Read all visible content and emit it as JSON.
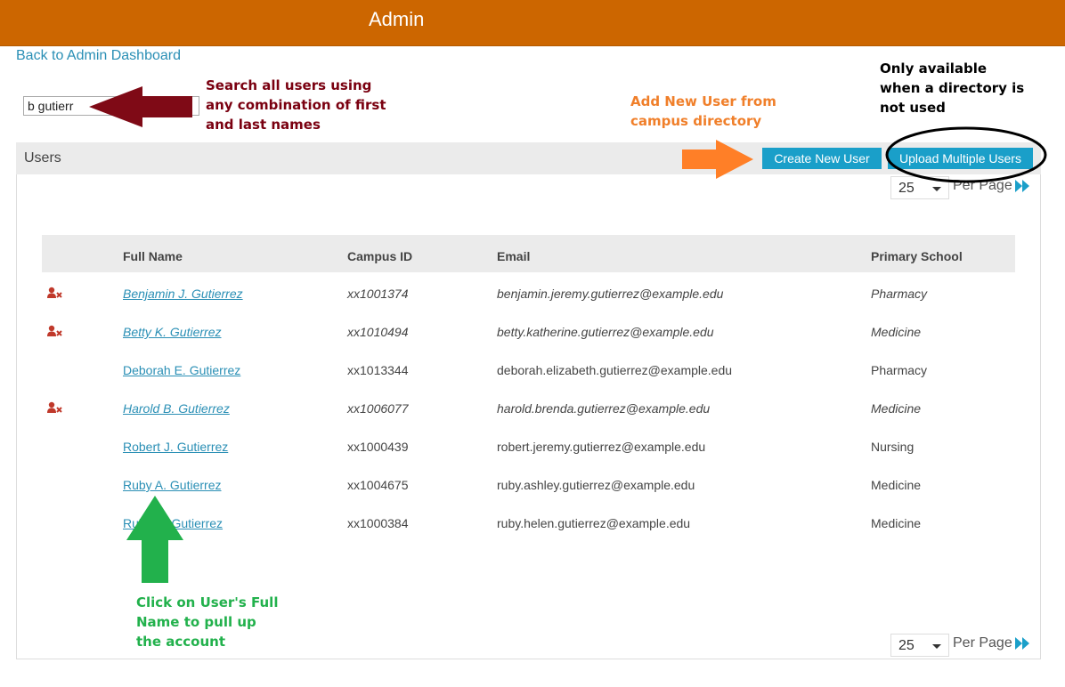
{
  "header": {
    "title": "Admin"
  },
  "nav": {
    "back_label": "Back to Admin Dashboard"
  },
  "search": {
    "value": "b gutierr"
  },
  "users_panel": {
    "title": "Users",
    "create_label": "Create New User",
    "upload_label": "Upload Multiple Users"
  },
  "pager_top": {
    "per_page_value": "25",
    "per_page_label": "Per Page"
  },
  "pager_bottom": {
    "per_page_value": "25",
    "per_page_label": "Per Page"
  },
  "table": {
    "headers": {
      "name": "Full Name",
      "campus_id": "Campus ID",
      "email": "Email",
      "school": "Primary School"
    },
    "rows": [
      {
        "name": "Benjamin J. Gutierrez",
        "campus_id": "xx1001374",
        "email": "benjamin.jeremy.gutierrez@example.edu",
        "school": "Pharmacy",
        "inactive": true
      },
      {
        "name": "Betty K. Gutierrez",
        "campus_id": "xx1010494",
        "email": "betty.katherine.gutierrez@example.edu",
        "school": "Medicine",
        "inactive": true
      },
      {
        "name": "Deborah E. Gutierrez",
        "campus_id": "xx1013344",
        "email": "deborah.elizabeth.gutierrez@example.edu",
        "school": "Pharmacy",
        "inactive": false
      },
      {
        "name": "Harold B. Gutierrez",
        "campus_id": "xx1006077",
        "email": "harold.brenda.gutierrez@example.edu",
        "school": "Medicine",
        "inactive": true
      },
      {
        "name": "Robert J. Gutierrez",
        "campus_id": "xx1000439",
        "email": "robert.jeremy.gutierrez@example.edu",
        "school": "Nursing",
        "inactive": false
      },
      {
        "name": "Ruby A. Gutierrez",
        "campus_id": "xx1004675",
        "email": "ruby.ashley.gutierrez@example.edu",
        "school": "Medicine",
        "inactive": false
      },
      {
        "name": "Ruby H. Gutierrez",
        "campus_id": "xx1000384",
        "email": "ruby.helen.gutierrez@example.edu",
        "school": "Medicine",
        "inactive": false
      }
    ]
  },
  "annotations": {
    "search_note": [
      "Search all users using",
      "any combination of first",
      "and last names"
    ],
    "add_note": [
      "Add New User from",
      "campus directory"
    ],
    "directory_note": [
      "Only available",
      "when a directory is",
      "not used"
    ],
    "click_note": [
      "Click on User's Full",
      "Name to pull up",
      "the account"
    ]
  },
  "icons": {
    "inactive_user": "user-remove-icon",
    "next_page": "fast-forward-icon",
    "dropdown": "caret-down-icon"
  },
  "colors": {
    "header": "#cc6600",
    "link": "#2a8fb5",
    "button": "#1a9fc9",
    "search_note": "#7a0010",
    "add_note": "#f07f2a",
    "click_note": "#22b14c",
    "inactive_icon": "#c0392b"
  }
}
